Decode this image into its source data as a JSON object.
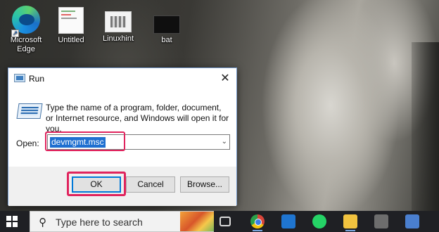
{
  "desktop": {
    "icons": [
      {
        "label": "Microsoft Edge",
        "icon": "edge-icon"
      },
      {
        "label": "Untitled",
        "icon": "document-icon"
      },
      {
        "label": "Linuxhint",
        "icon": "image-icon"
      },
      {
        "label": "bat",
        "icon": "terminal-icon"
      }
    ]
  },
  "run_dialog": {
    "title": "Run",
    "description": "Type the name of a program, folder, document, or Internet resource, and Windows will open it for you.",
    "open_label": "Open:",
    "open_value": "devmgmt.msc",
    "buttons": {
      "ok": "OK",
      "cancel": "Cancel",
      "browse": "Browse..."
    },
    "highlight_color": "#e0245e"
  },
  "taskbar": {
    "search_placeholder": "Type here to search",
    "pinned": [
      "task-view-icon",
      "chrome-icon",
      "mail-icon",
      "whatsapp-icon",
      "file-explorer-icon",
      "calculator-icon",
      "app-icon"
    ]
  }
}
